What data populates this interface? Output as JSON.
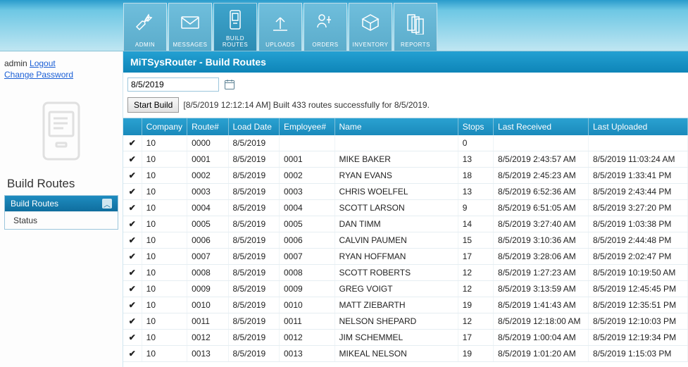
{
  "nav": {
    "items": [
      {
        "label": "ADMIN",
        "icon": "wrench"
      },
      {
        "label": "MESSAGES",
        "icon": "envelope"
      },
      {
        "label": "BUILD ROUTES",
        "icon": "device",
        "active": true
      },
      {
        "label": "UPLOADS",
        "icon": "upload"
      },
      {
        "label": "ORDERS",
        "icon": "orders"
      },
      {
        "label": "INVENTORY",
        "icon": "boxes"
      },
      {
        "label": "REPORTS",
        "icon": "reports"
      }
    ]
  },
  "sidebar": {
    "user_label": "admin",
    "logout_label": "Logout",
    "change_pw_label": "Change Password",
    "section_title": "Build Routes",
    "panel_header": "Build Routes",
    "panel_items": [
      "Status"
    ]
  },
  "page": {
    "title": "MiTSysRouter - Build Routes",
    "date_value": "8/5/2019",
    "start_build_label": "Start Build",
    "status_message": "[8/5/2019 12:12:14 AM] Built 433 routes successfully for 8/5/2019."
  },
  "grid": {
    "headers": {
      "company": "Company",
      "route": "Route#",
      "load_date": "Load Date",
      "employee": "Employee#",
      "name": "Name",
      "stops": "Stops",
      "last_received": "Last Received",
      "last_uploaded": "Last Uploaded"
    },
    "rows": [
      {
        "company": "10",
        "route": "0000",
        "load_date": "8/5/2019",
        "employee": "",
        "name": "",
        "stops": "0",
        "last_received": "",
        "last_uploaded": ""
      },
      {
        "company": "10",
        "route": "0001",
        "load_date": "8/5/2019",
        "employee": "0001",
        "name": "MIKE BAKER",
        "stops": "13",
        "last_received": "8/5/2019 2:43:57 AM",
        "last_uploaded": "8/5/2019 11:03:24 AM"
      },
      {
        "company": "10",
        "route": "0002",
        "load_date": "8/5/2019",
        "employee": "0002",
        "name": "RYAN EVANS",
        "stops": "18",
        "last_received": "8/5/2019 2:45:23 AM",
        "last_uploaded": "8/5/2019 1:33:41 PM"
      },
      {
        "company": "10",
        "route": "0003",
        "load_date": "8/5/2019",
        "employee": "0003",
        "name": "CHRIS WOELFEL",
        "stops": "13",
        "last_received": "8/5/2019 6:52:36 AM",
        "last_uploaded": "8/5/2019 2:43:44 PM"
      },
      {
        "company": "10",
        "route": "0004",
        "load_date": "8/5/2019",
        "employee": "0004",
        "name": "SCOTT LARSON",
        "stops": "9",
        "last_received": "8/5/2019 6:51:05 AM",
        "last_uploaded": "8/5/2019 3:27:20 PM"
      },
      {
        "company": "10",
        "route": "0005",
        "load_date": "8/5/2019",
        "employee": "0005",
        "name": "DAN TIMM",
        "stops": "14",
        "last_received": "8/5/2019 3:27:40 AM",
        "last_uploaded": "8/5/2019 1:03:38 PM"
      },
      {
        "company": "10",
        "route": "0006",
        "load_date": "8/5/2019",
        "employee": "0006",
        "name": "CALVIN PAUMEN",
        "stops": "15",
        "last_received": "8/5/2019 3:10:36 AM",
        "last_uploaded": "8/5/2019 2:44:48 PM"
      },
      {
        "company": "10",
        "route": "0007",
        "load_date": "8/5/2019",
        "employee": "0007",
        "name": "RYAN HOFFMAN",
        "stops": "17",
        "last_received": "8/5/2019 3:28:06 AM",
        "last_uploaded": "8/5/2019 2:02:47 PM"
      },
      {
        "company": "10",
        "route": "0008",
        "load_date": "8/5/2019",
        "employee": "0008",
        "name": "SCOTT ROBERTS",
        "stops": "12",
        "last_received": "8/5/2019 1:27:23 AM",
        "last_uploaded": "8/5/2019 10:19:50 AM"
      },
      {
        "company": "10",
        "route": "0009",
        "load_date": "8/5/2019",
        "employee": "0009",
        "name": "GREG VOIGT",
        "stops": "12",
        "last_received": "8/5/2019 3:13:59 AM",
        "last_uploaded": "8/5/2019 12:45:45 PM"
      },
      {
        "company": "10",
        "route": "0010",
        "load_date": "8/5/2019",
        "employee": "0010",
        "name": "MATT ZIEBARTH",
        "stops": "19",
        "last_received": "8/5/2019 1:41:43 AM",
        "last_uploaded": "8/5/2019 12:35:51 PM"
      },
      {
        "company": "10",
        "route": "0011",
        "load_date": "8/5/2019",
        "employee": "0011",
        "name": "NELSON SHEPARD",
        "stops": "12",
        "last_received": "8/5/2019 12:18:00 AM",
        "last_uploaded": "8/5/2019 12:10:03 PM"
      },
      {
        "company": "10",
        "route": "0012",
        "load_date": "8/5/2019",
        "employee": "0012",
        "name": "JIM SCHEMMEL",
        "stops": "17",
        "last_received": "8/5/2019 1:00:04 AM",
        "last_uploaded": "8/5/2019 12:19:34 PM"
      },
      {
        "company": "10",
        "route": "0013",
        "load_date": "8/5/2019",
        "employee": "0013",
        "name": "MIKEAL NELSON",
        "stops": "19",
        "last_received": "8/5/2019 1:01:20 AM",
        "last_uploaded": "8/5/2019 1:15:03 PM"
      }
    ]
  }
}
